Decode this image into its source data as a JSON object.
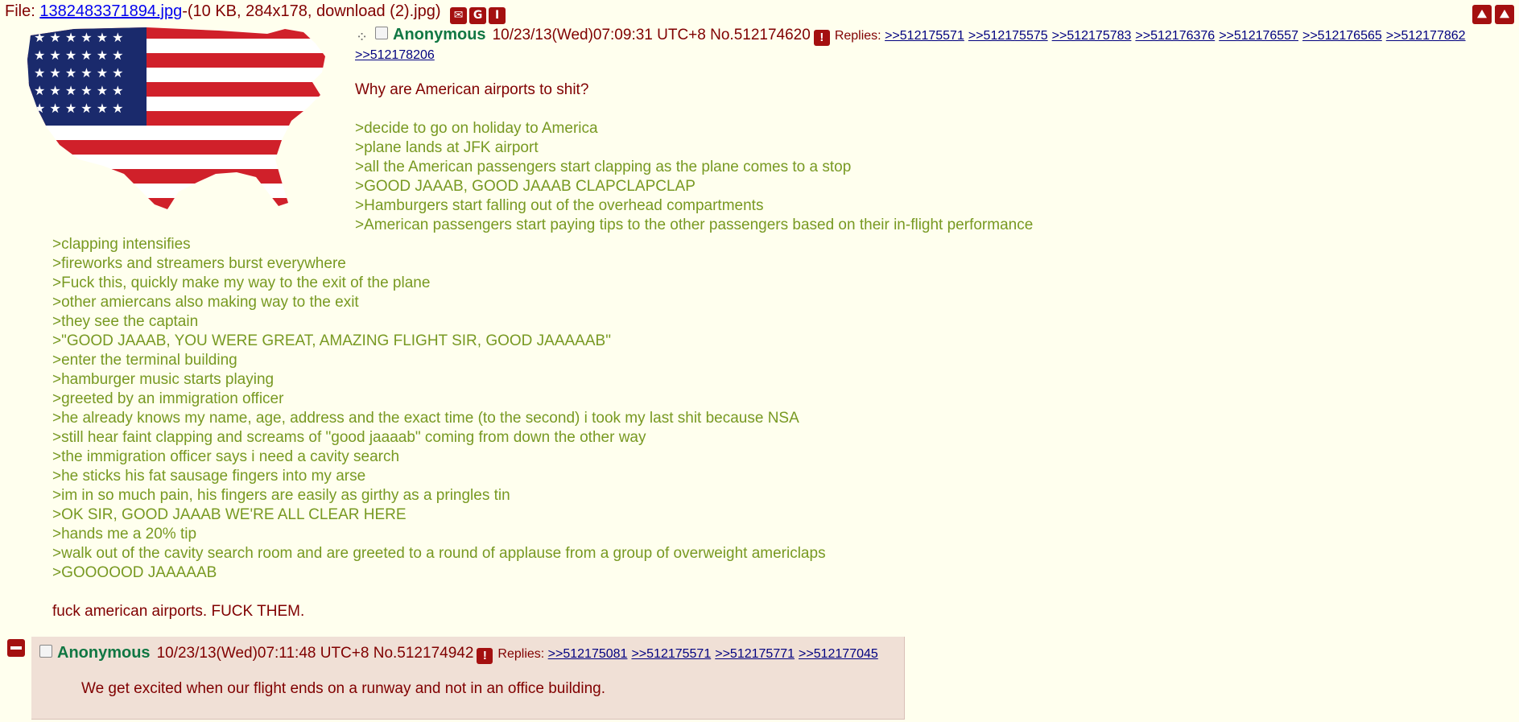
{
  "file": {
    "prefix": "File: ",
    "filename": "1382483371894.jpg",
    "meta": "-(10 KB, 284x178, download (2).jpg)"
  },
  "op": {
    "name": "Anonymous",
    "datetime": "10/23/13(Wed)07:09:31 UTC+8",
    "number": "No.512174620",
    "replies_label": "Replies:",
    "replies": [
      ">>512175571",
      ">>512175575",
      ">>512175783",
      ">>512176376",
      ">>512176557",
      ">>512176565",
      ">>512177862"
    ],
    "replies_wrap": ">>512178206",
    "lines": [
      {
        "text": "Why are American airports to shit?",
        "quote": false
      },
      {
        "text": "",
        "quote": false
      },
      {
        "text": ">decide to go on holiday to America",
        "quote": true
      },
      {
        "text": ">plane lands at JFK airport",
        "quote": true
      },
      {
        "text": ">all the American passengers start clapping as the plane comes to a stop",
        "quote": true
      },
      {
        "text": ">GOOD JAAAB, GOOD JAAAB CLAPCLAPCLAP",
        "quote": true
      },
      {
        "text": ">Hamburgers start falling out of the overhead compartments",
        "quote": true
      },
      {
        "text": ">American passengers start paying tips to the other passengers based on their in-flight performance",
        "quote": true
      }
    ],
    "lines_lower": [
      {
        "text": ">clapping intensifies",
        "quote": true
      },
      {
        "text": ">fireworks and streamers burst everywhere",
        "quote": true
      },
      {
        "text": ">Fuck this, quickly make my way to the exit of the plane",
        "quote": true
      },
      {
        "text": ">other amiercans also making way to the exit",
        "quote": true
      },
      {
        "text": ">they see the captain",
        "quote": true
      },
      {
        "text": ">\"GOOD JAAAB, YOU WERE GREAT, AMAZING FLIGHT SIR, GOOD JAAAAAB\"",
        "quote": true
      },
      {
        "text": ">enter the terminal building",
        "quote": true
      },
      {
        "text": ">hamburger music starts playing",
        "quote": true
      },
      {
        "text": ">greeted by an immigration officer",
        "quote": true
      },
      {
        "text": ">he already knows my name, age, address and the exact time (to the second) i took my last shit because NSA",
        "quote": true
      },
      {
        "text": ">still hear faint clapping and screams of \"good jaaaab\" coming from down the other way",
        "quote": true
      },
      {
        "text": ">the immigration officer says i need a cavity search",
        "quote": true
      },
      {
        "text": ">he sticks his fat sausage fingers into my arse",
        "quote": true
      },
      {
        "text": ">im in so much pain, his fingers are easily as girthy as a pringles tin",
        "quote": true
      },
      {
        "text": ">OK SIR, GOOD JAAAB WE'RE ALL CLEAR HERE",
        "quote": true
      },
      {
        "text": ">hands me a 20% tip",
        "quote": true
      },
      {
        "text": ">walk out of the cavity search room and are greeted to a round of applause from a group of overweight americlaps",
        "quote": true
      },
      {
        "text": ">GOOOOOD JAAAAAB",
        "quote": true
      },
      {
        "text": "",
        "quote": false
      },
      {
        "text": "fuck american airports. FUCK THEM.",
        "quote": false
      }
    ]
  },
  "reply": {
    "name": "Anonymous",
    "datetime": "10/23/13(Wed)07:11:48 UTC+8",
    "number": "No.512174942",
    "replies_label": "Replies:",
    "replies": [
      ">>512175081",
      ">>512175571",
      ">>512175771",
      ">>512177045"
    ],
    "message": "We get excited when our flight ends on a runway and not in an office building."
  },
  "colors": {
    "background": "#ffffee",
    "text": "#800000",
    "greentext": "#789922",
    "name": "#117743",
    "reply_bg": "#f0e0d6",
    "link": "#000080"
  },
  "icons": {
    "file_icons": [
      "email-icon",
      "google-icon",
      "iqdb-icon"
    ],
    "top_right": [
      "image-expand-icon",
      "collapse-icon"
    ]
  }
}
